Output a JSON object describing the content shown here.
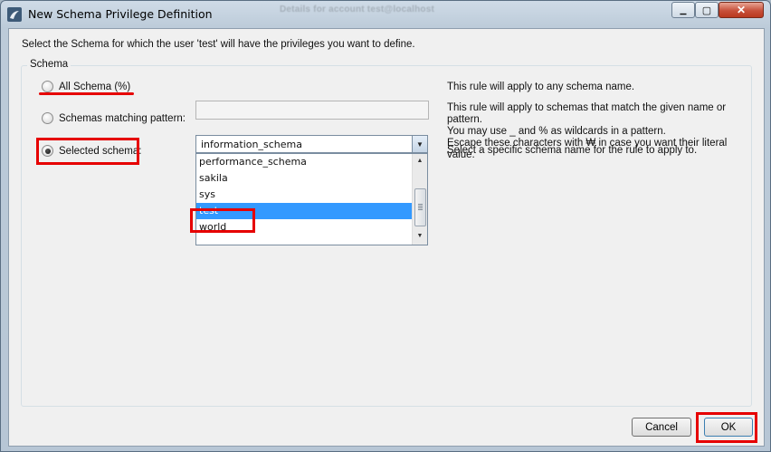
{
  "window": {
    "title": "New Schema Privilege Definition",
    "background_title": "Details for account test@localhost",
    "close_glyph": "✕",
    "minimize_glyph": "▁",
    "maximize_glyph": "▢"
  },
  "instruction": "Select the Schema for which the user 'test' will have the privileges you want to define.",
  "group": {
    "label": "Schema"
  },
  "options": {
    "all": {
      "label": "All Schema (%)",
      "checked": false,
      "description": "This rule will apply to any schema name."
    },
    "pattern": {
      "label": "Schemas matching pattern:",
      "checked": false,
      "value": "",
      "description_lines": [
        "This rule will apply to schemas that match the given name or pattern.",
        "You may use _ and % as wildcards in a pattern.",
        "Escape these characters with ₩ in case you want their literal value."
      ]
    },
    "selected": {
      "label": "Selected schema:",
      "checked": true,
      "combo_value": "information_schema",
      "description": "Select a specific schema name for the rule to apply to."
    }
  },
  "dropdown": {
    "items": [
      "performance_schema",
      "sakila",
      "sys",
      "test",
      "world"
    ],
    "selected_index": 3
  },
  "buttons": {
    "cancel": "Cancel",
    "ok": "OK"
  },
  "colors": {
    "highlight": "#e60000",
    "selection": "#3399ff",
    "dialog_bg": "#f0f0f0"
  },
  "icons": {
    "app": "mysql-workbench-icon",
    "combo": "chevron-down-icon",
    "scroll_up": "scroll-up-arrow-icon",
    "scroll_down": "scroll-down-arrow-icon"
  }
}
